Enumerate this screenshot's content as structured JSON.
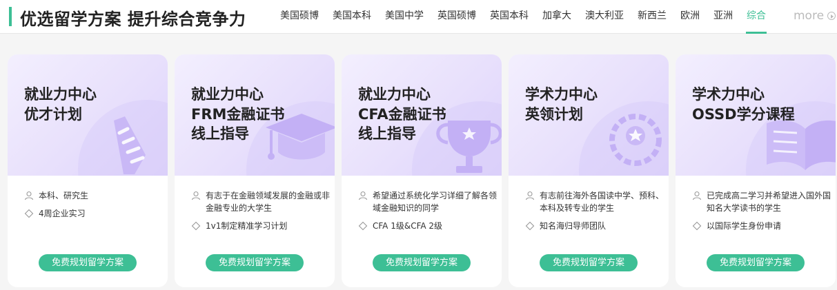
{
  "header": {
    "title": "优选留学方案 提升综合竞争力",
    "tabs": [
      {
        "label": "美国硕博",
        "active": false
      },
      {
        "label": "美国本科",
        "active": false
      },
      {
        "label": "美国中学",
        "active": false
      },
      {
        "label": "英国硕博",
        "active": false
      },
      {
        "label": "英国本科",
        "active": false
      },
      {
        "label": "加拿大",
        "active": false
      },
      {
        "label": "澳大利亚",
        "active": false
      },
      {
        "label": "新西兰",
        "active": false
      },
      {
        "label": "欧洲",
        "active": false
      },
      {
        "label": "亚洲",
        "active": false
      },
      {
        "label": "综合",
        "active": true
      }
    ],
    "more": "more",
    "accent": "#3dbf95"
  },
  "cards": [
    {
      "title_lines": [
        "就业力中心",
        "优才计划"
      ],
      "deco": "tie-icon",
      "audience": "本科、研究生",
      "benefit": "4周企业实习",
      "cta": "免费规划留学方案"
    },
    {
      "title_lines": [
        "就业力中心",
        "FRM金融证书",
        "线上指导"
      ],
      "deco": "graduation-cap-icon",
      "audience": "有志于在金融领域发展的金融或非金融专业的大学生",
      "benefit": "1v1制定精准学习计划",
      "cta": "免费规划留学方案"
    },
    {
      "title_lines": [
        "就业力中心",
        "CFA金融证书",
        "线上指导"
      ],
      "deco": "trophy-icon",
      "audience": "希望通过系统化学习详细了解各领域金融知识的同学",
      "benefit": "CFA 1级&CFA 2级",
      "cta": "免费规划留学方案"
    },
    {
      "title_lines": [
        "学术力中心",
        "英领计划"
      ],
      "deco": "medal-icon",
      "audience": "有志前往海外各国读中学、预科、本科及转专业的学生",
      "benefit": "知名海归导师团队",
      "cta": "免费规划留学方案"
    },
    {
      "title_lines": [
        "学术力中心",
        "OSSD学分课程"
      ],
      "deco": "book-icon",
      "audience": "已完成高二学习并希望进入国外国知名大学读书的学生",
      "benefit": "以国际学生身份申请",
      "cta": "免费规划留学方案"
    }
  ]
}
